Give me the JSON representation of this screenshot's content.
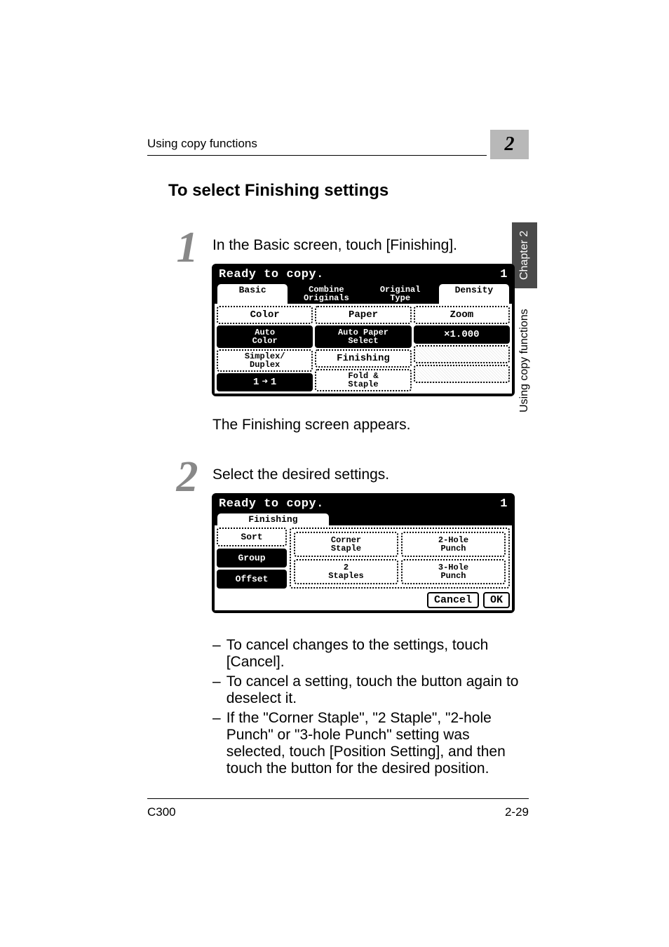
{
  "running_head": "Using copy functions",
  "chapter_badge": "2",
  "section_title": "To select Finishing settings",
  "side_tab": "Chapter 2",
  "side_label": "Using copy functions",
  "footer_left": "C300",
  "footer_right": "2-29",
  "step1": {
    "num": "1",
    "text": "In the Basic screen, touch [Finishing].",
    "followup": "The Finishing screen appears."
  },
  "step2": {
    "num": "2",
    "text": "Select the desired settings."
  },
  "bullets": [
    "To cancel changes to the settings, touch [Cancel].",
    "To cancel a setting, touch the button again to deselect it.",
    "If the \"Corner Staple\", \"2 Staple\", \"2-hole Punch\" or \"3-hole Punch\" setting was selected, touch [Position Setting], and then touch the button for the desired position."
  ],
  "lcd1": {
    "status": "Ready to copy.",
    "count": "1",
    "tabs": {
      "basic": "Basic",
      "combine_l1": "Combine",
      "combine_l2": "Originals",
      "orig_l1": "Original",
      "orig_l2": "Type",
      "density": "Density"
    },
    "color_label": "Color",
    "color_val_l1": "Auto",
    "color_val_l2": "Color",
    "paper_label": "Paper",
    "paper_val_l1": "Auto Paper",
    "paper_val_l2": "Select",
    "zoom_label": "Zoom",
    "zoom_val": "×1.000",
    "simplex_l1": "Simplex/",
    "simplex_l2": "Duplex",
    "simplex_val_left": "1",
    "simplex_val_right": "1",
    "finishing_label": "Finishing",
    "fold_l1": "Fold &",
    "fold_l2": "Staple"
  },
  "lcd2": {
    "status": "Ready to copy.",
    "count": "1",
    "title_tab": "Finishing",
    "sort": "Sort",
    "group": "Group",
    "offset": "Offset",
    "corner_l1": "Corner",
    "corner_l2": "Staple",
    "staples_l1": "2",
    "staples_l2": "Staples",
    "p2_l1": "2-Hole",
    "p2_l2": "Punch",
    "p3_l1": "3-Hole",
    "p3_l2": "Punch",
    "cancel": "Cancel",
    "ok": "OK"
  }
}
